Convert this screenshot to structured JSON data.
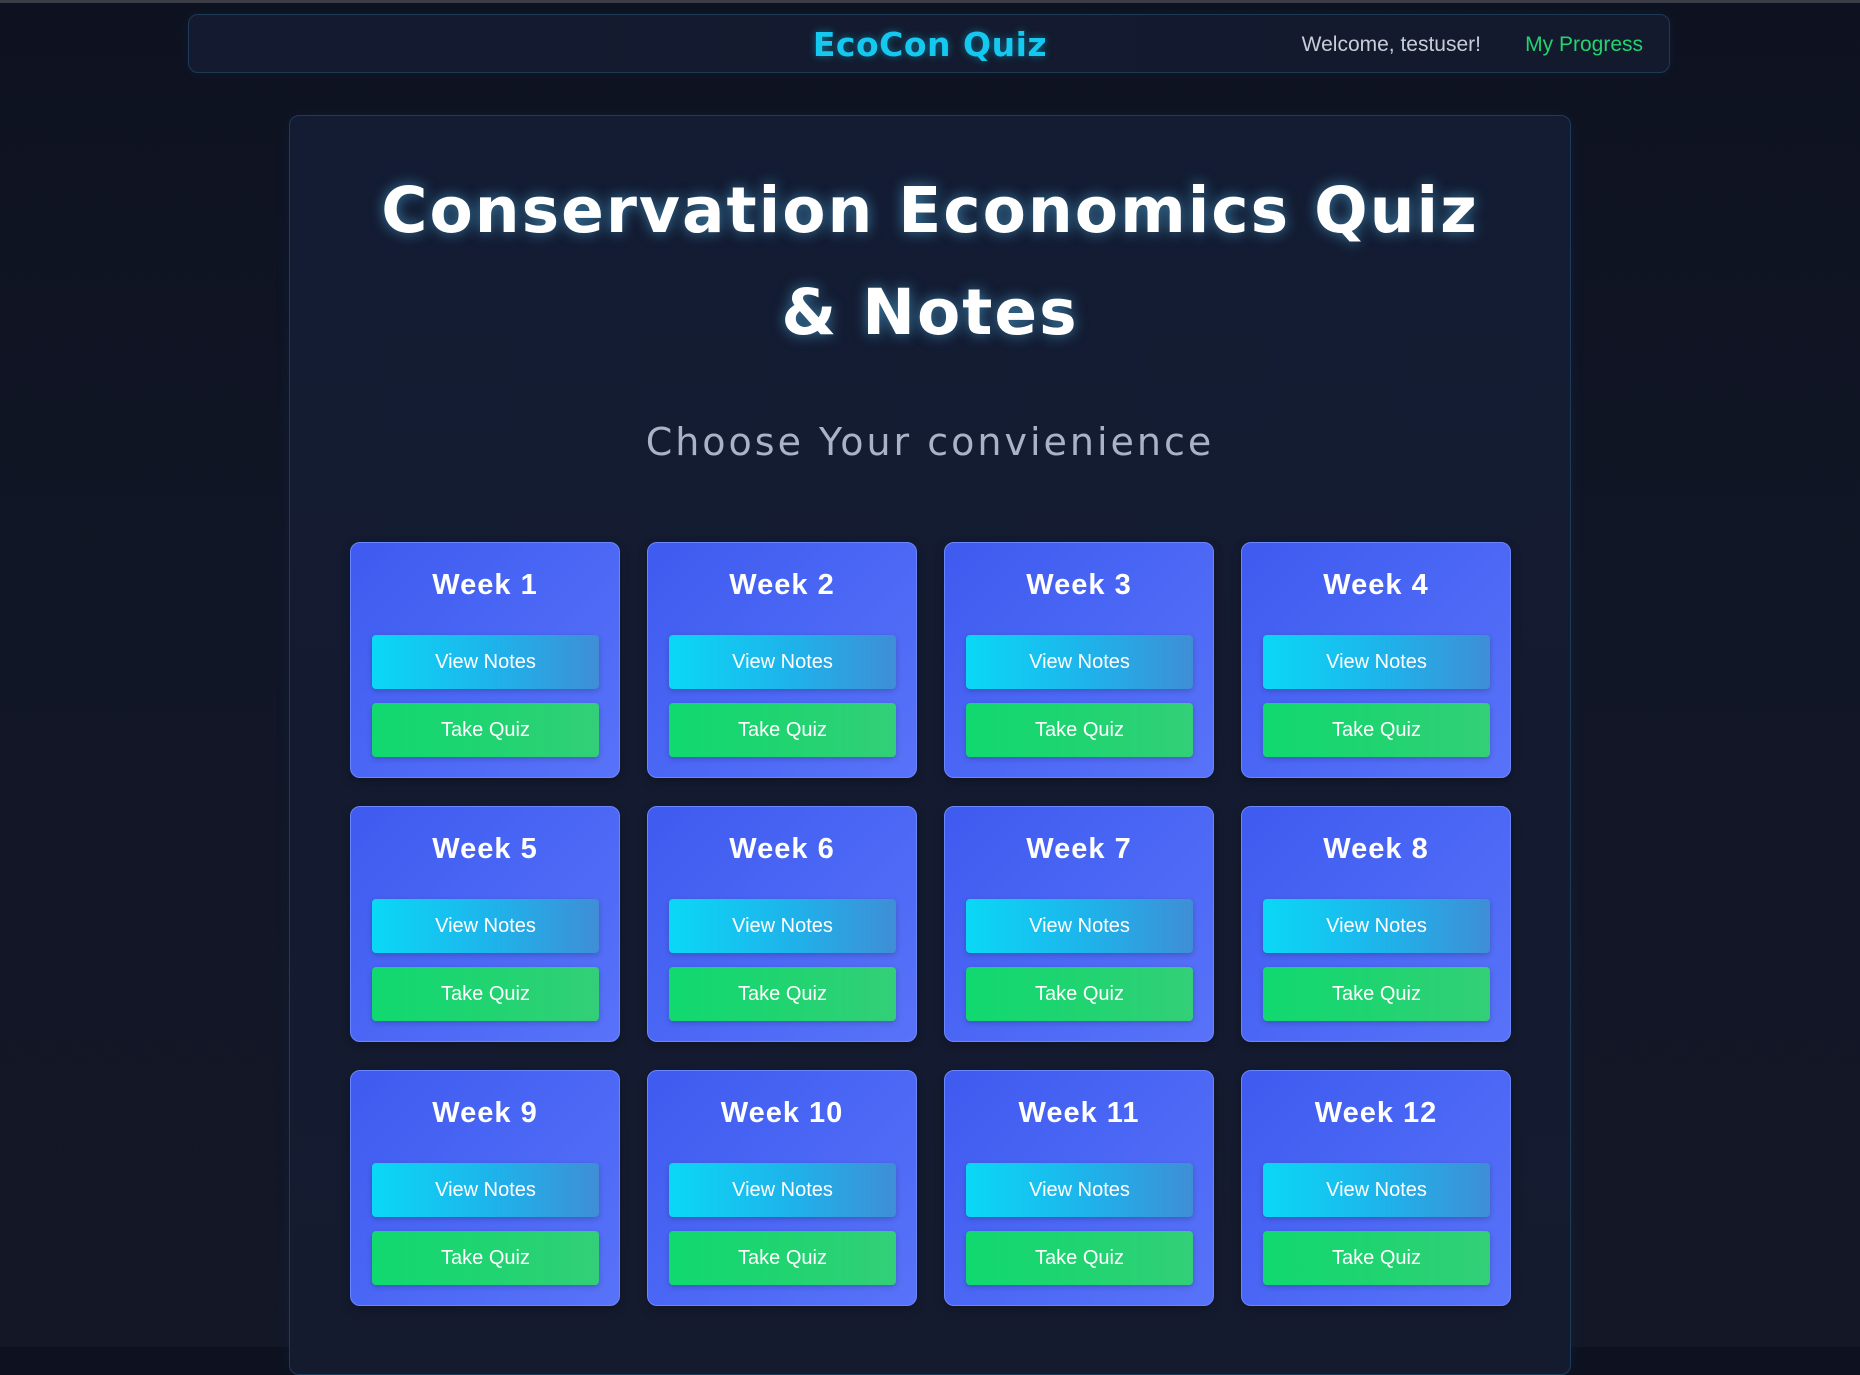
{
  "nav": {
    "brand": "EcoCon Quiz",
    "welcome": "Welcome, testuser!",
    "progress_link": "My Progress"
  },
  "page": {
    "title_line1": "Conservation Economics Quiz",
    "title_line2": "& Notes",
    "subtitle": "Choose Your convienience"
  },
  "weeks": [
    {
      "title": "Week 1",
      "notes_label": "View Notes",
      "quiz_label": "Take Quiz"
    },
    {
      "title": "Week 2",
      "notes_label": "View Notes",
      "quiz_label": "Take Quiz"
    },
    {
      "title": "Week 3",
      "notes_label": "View Notes",
      "quiz_label": "Take Quiz"
    },
    {
      "title": "Week 4",
      "notes_label": "View Notes",
      "quiz_label": "Take Quiz"
    },
    {
      "title": "Week 5",
      "notes_label": "View Notes",
      "quiz_label": "Take Quiz"
    },
    {
      "title": "Week 6",
      "notes_label": "View Notes",
      "quiz_label": "Take Quiz"
    },
    {
      "title": "Week 7",
      "notes_label": "View Notes",
      "quiz_label": "Take Quiz"
    },
    {
      "title": "Week 8",
      "notes_label": "View Notes",
      "quiz_label": "Take Quiz"
    },
    {
      "title": "Week 9",
      "notes_label": "View Notes",
      "quiz_label": "Take Quiz"
    },
    {
      "title": "Week 10",
      "notes_label": "View Notes",
      "quiz_label": "Take Quiz"
    },
    {
      "title": "Week 11",
      "notes_label": "View Notes",
      "quiz_label": "Take Quiz"
    },
    {
      "title": "Week 12",
      "notes_label": "View Notes",
      "quiz_label": "Take Quiz"
    }
  ],
  "colors": {
    "brand": "#14c8f0",
    "progress_link": "#22d36f",
    "card": "#4c68f5",
    "notes_button": "#0ad8f6",
    "quiz_button": "#10d96f"
  }
}
